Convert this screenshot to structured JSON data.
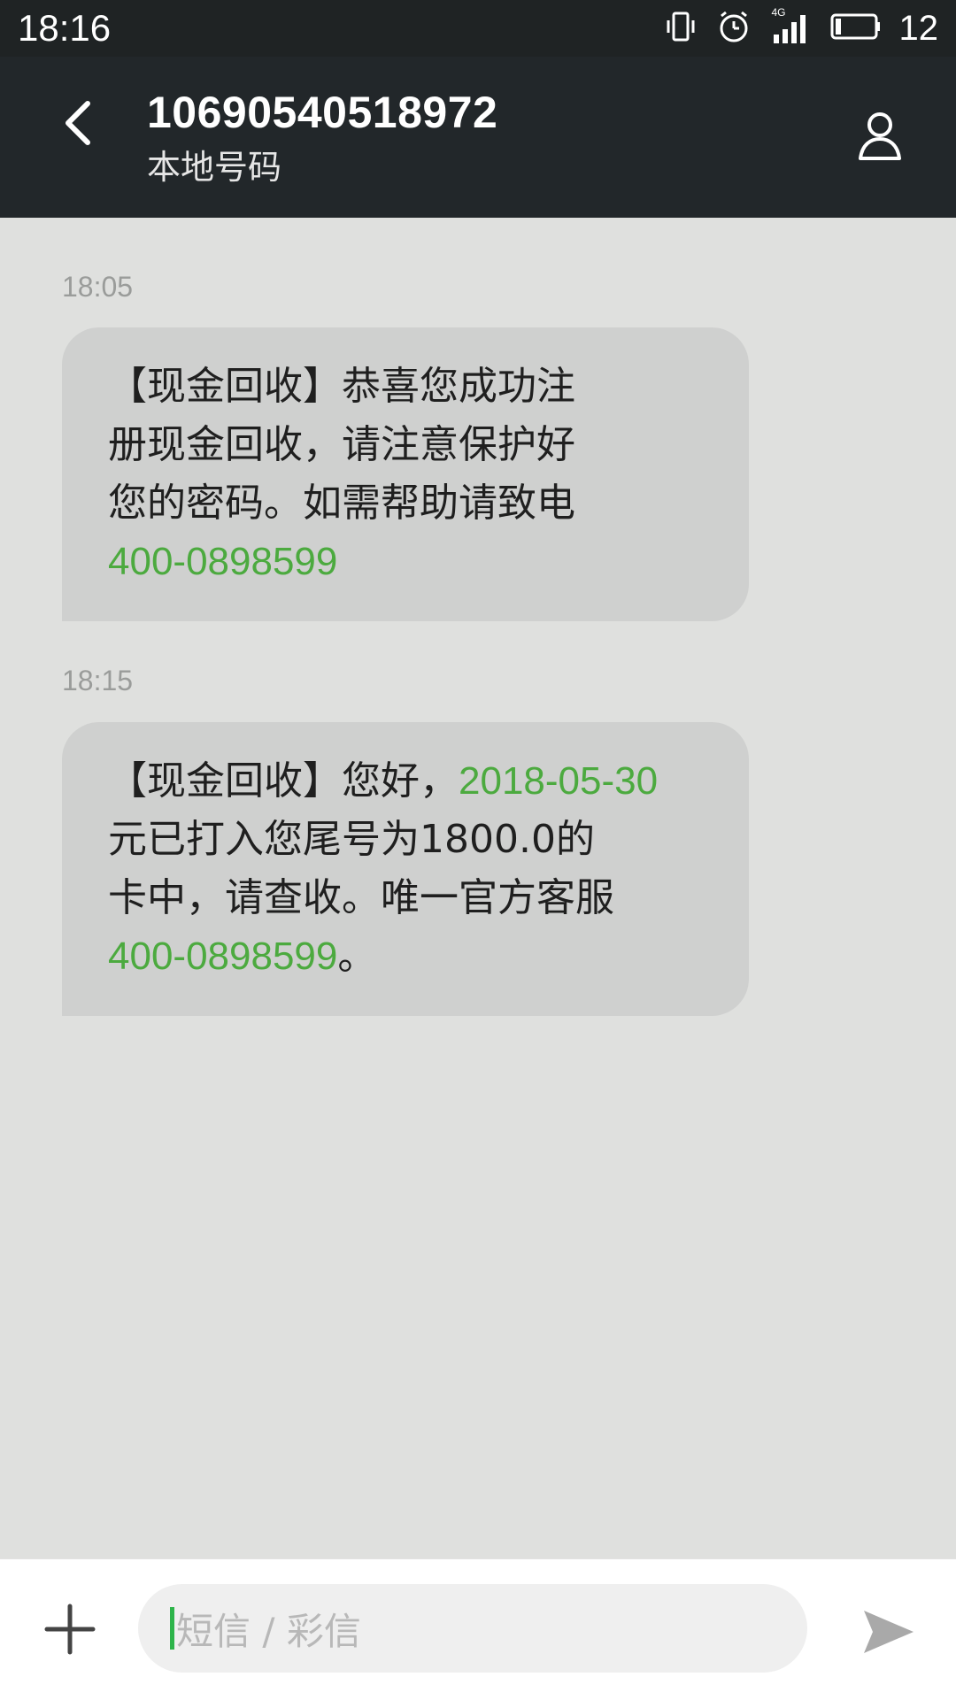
{
  "status_bar": {
    "time": "18:16",
    "network": "4G",
    "battery_level": "12",
    "icons": [
      "vibrate-icon",
      "alarm-icon",
      "signal-icon",
      "battery-icon"
    ]
  },
  "header": {
    "title": "10690540518972",
    "subtitle": "本地号码",
    "icons": [
      "back-arrow-icon",
      "contact-person-icon"
    ]
  },
  "messages": [
    {
      "timestamp": "18:05",
      "lines": [
        {
          "text": "【现金回收】恭喜您成功注"
        },
        {
          "text": "册现金回收，请注意保护好"
        },
        {
          "text": "您的密码。如需帮助请致电"
        },
        {
          "link": "400-0898599"
        }
      ]
    },
    {
      "timestamp": "18:15",
      "lines": [
        {
          "text": "【现金回收】您好，",
          "link": "2018-05-30"
        },
        {
          "text": "元已打入您尾号为1800.0的"
        },
        {
          "text": "卡中，请查收。唯一官方客服"
        },
        {
          "link": "400-0898599",
          "text_after": "。"
        }
      ]
    }
  ],
  "composer": {
    "placeholder": "短信 / 彩信",
    "icons": [
      "add-icon",
      "send-icon"
    ]
  },
  "colors": {
    "status_bar_bg": "#1f2324",
    "header_bg": "#22272a",
    "chat_bg": "#dfe0de",
    "bubble_bg": "#cfd0cf",
    "link": "#4caa3f",
    "cursor": "#2db44a"
  }
}
